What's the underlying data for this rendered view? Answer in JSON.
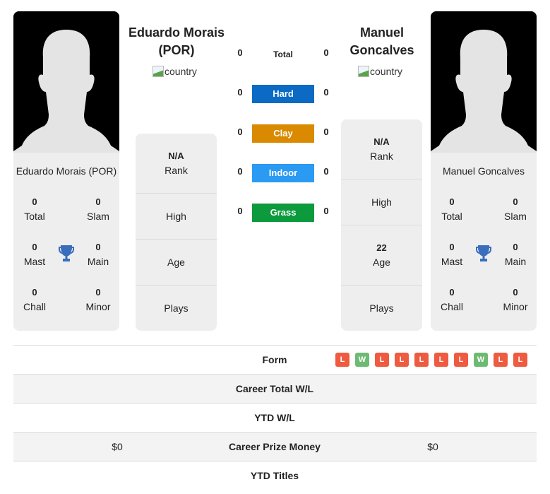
{
  "colors": {
    "hard": "#0a6ac4",
    "clay": "#d98a00",
    "indoor": "#2b9af3",
    "grass": "#0b9a3c",
    "win": "#6dbb72",
    "loss": "#ef5b40",
    "trophy": "#3a6ebd"
  },
  "player1": {
    "name_header": "Eduardo Morais (POR)",
    "card_name": "Eduardo Morais (POR)",
    "country_alt": "country",
    "titles": {
      "total": {
        "value": "0",
        "label": "Total"
      },
      "slam": {
        "value": "0",
        "label": "Slam"
      },
      "mast": {
        "value": "0",
        "label": "Mast"
      },
      "main": {
        "value": "0",
        "label": "Main"
      },
      "chall": {
        "value": "0",
        "label": "Chall"
      },
      "minor": {
        "value": "0",
        "label": "Minor"
      }
    },
    "info": {
      "rank": {
        "value": "N/A",
        "label": "Rank"
      },
      "high": {
        "value": "",
        "label": "High"
      },
      "age": {
        "value": "",
        "label": "Age"
      },
      "plays": {
        "value": "",
        "label": "Plays"
      }
    }
  },
  "player2": {
    "name_header": "Manuel Goncalves",
    "card_name": "Manuel Goncalves",
    "country_alt": "country",
    "titles": {
      "total": {
        "value": "0",
        "label": "Total"
      },
      "slam": {
        "value": "0",
        "label": "Slam"
      },
      "mast": {
        "value": "0",
        "label": "Mast"
      },
      "main": {
        "value": "0",
        "label": "Main"
      },
      "chall": {
        "value": "0",
        "label": "Chall"
      },
      "minor": {
        "value": "0",
        "label": "Minor"
      }
    },
    "info": {
      "rank": {
        "value": "N/A",
        "label": "Rank"
      },
      "high": {
        "value": "",
        "label": "High"
      },
      "age": {
        "value": "22",
        "label": "Age"
      },
      "plays": {
        "value": "",
        "label": "Plays"
      }
    }
  },
  "h2h": [
    {
      "surface": "Total",
      "p1": "0",
      "p2": "0"
    },
    {
      "surface": "Hard",
      "p1": "0",
      "p2": "0"
    },
    {
      "surface": "Clay",
      "p1": "0",
      "p2": "0"
    },
    {
      "surface": "Indoor",
      "p1": "0",
      "p2": "0"
    },
    {
      "surface": "Grass",
      "p1": "0",
      "p2": "0"
    }
  ],
  "comparison": {
    "form": {
      "label": "Form",
      "p2_results": [
        "L",
        "W",
        "L",
        "L",
        "L",
        "L",
        "L",
        "W",
        "L",
        "L"
      ]
    },
    "career_total_wl": {
      "label": "Career Total W/L",
      "p1": "",
      "p2": ""
    },
    "ytd_wl": {
      "label": "YTD W/L",
      "p1": "",
      "p2": ""
    },
    "career_prize_money": {
      "label": "Career Prize Money",
      "p1": "$0",
      "p2": "$0"
    },
    "ytd_titles": {
      "label": "YTD Titles",
      "p1": "",
      "p2": ""
    }
  }
}
